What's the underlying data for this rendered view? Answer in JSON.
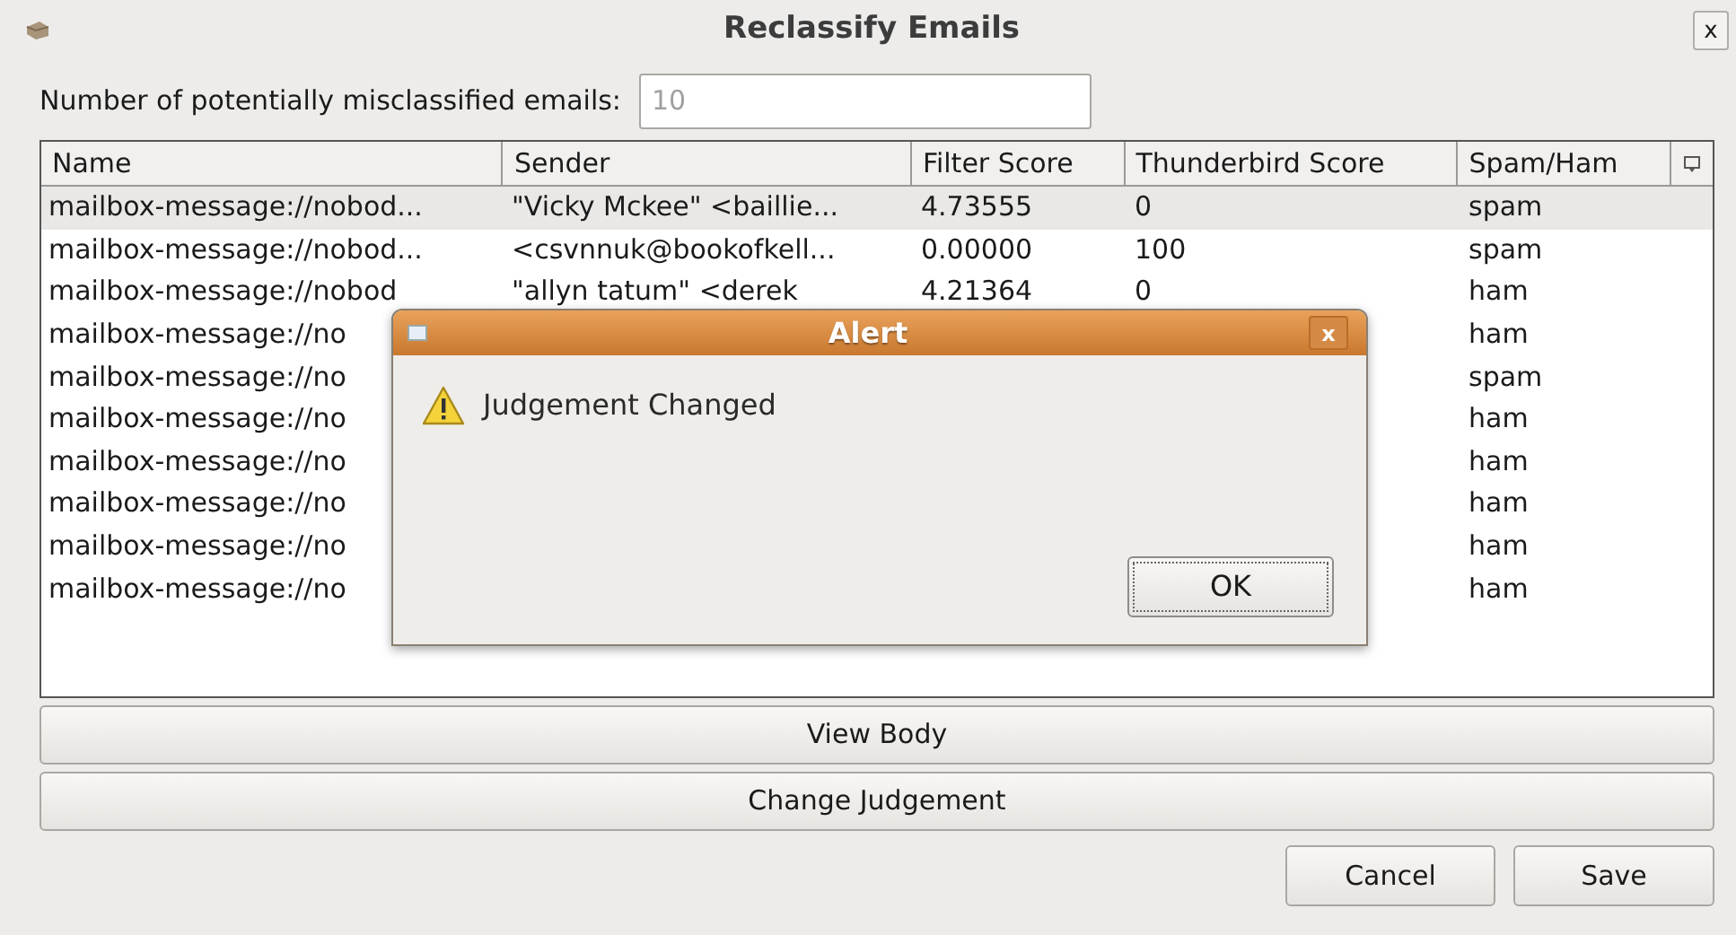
{
  "window": {
    "title": "Reclassify Emails",
    "close": "x"
  },
  "count": {
    "label": "Number of potentially misclassified emails:",
    "value": "10"
  },
  "table": {
    "columns": [
      "Name",
      "Sender",
      "Filter Score",
      "Thunderbird Score",
      "Spam/Ham"
    ],
    "rows": [
      {
        "name": "mailbox-message://nobod...",
        "sender": "\"Vicky Mckee\" <baillie...",
        "filter_score": "4.73555",
        "thunderbird_score": "0",
        "label": "spam",
        "selected": true
      },
      {
        "name": "mailbox-message://nobod...",
        "sender": "<csvnnuk@bookofkell...",
        "filter_score": "0.00000",
        "thunderbird_score": "100",
        "label": "spam",
        "selected": false
      },
      {
        "name": "mailbox-message://nobod",
        "sender": "\"allyn tatum\" <derek",
        "filter_score": "4.21364",
        "thunderbird_score": "0",
        "label": "ham",
        "selected": false
      },
      {
        "name": "mailbox-message://no",
        "label": "ham",
        "selected": false
      },
      {
        "name": "mailbox-message://no",
        "label": "spam",
        "selected": false
      },
      {
        "name": "mailbox-message://no",
        "label": "ham",
        "selected": false
      },
      {
        "name": "mailbox-message://no",
        "label": "ham",
        "selected": false
      },
      {
        "name": "mailbox-message://no",
        "label": "ham",
        "selected": false
      },
      {
        "name": "mailbox-message://no",
        "label": "ham",
        "selected": false
      },
      {
        "name": "mailbox-message://no",
        "label": "ham",
        "selected": false
      }
    ]
  },
  "actions": [
    "View Body",
    "Change Judgement"
  ],
  "buttons": [
    "Cancel",
    "Save"
  ],
  "alert": {
    "title": "Alert",
    "close": "x",
    "message": "Judgement Changed",
    "button": "OK"
  }
}
